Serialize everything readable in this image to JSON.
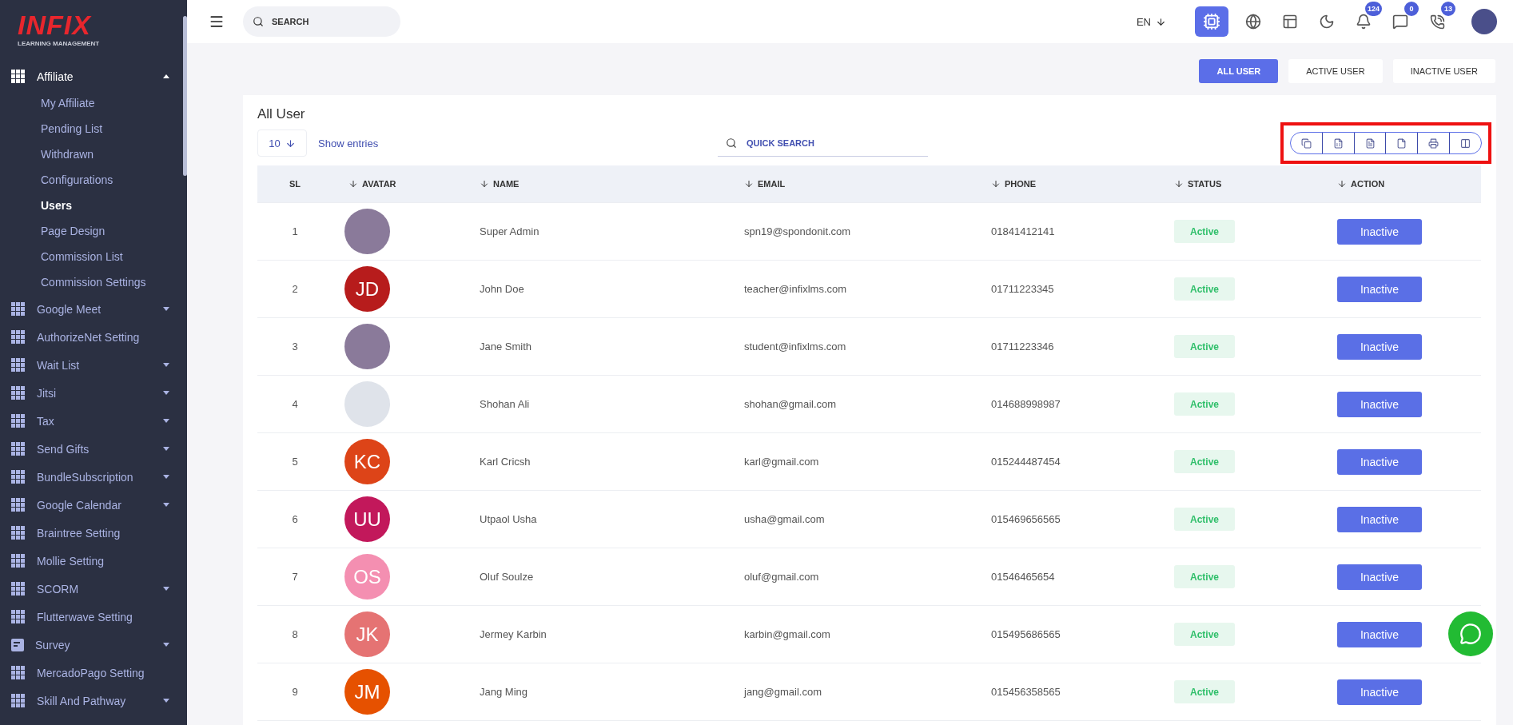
{
  "sidebar": {
    "logo": {
      "brand": "INFIX",
      "tagline": "LEARNING MANAGEMENT"
    },
    "items": [
      {
        "label": "Affiliate",
        "kind": "group",
        "expanded": true,
        "children": [
          {
            "label": "My Affiliate",
            "selected": false
          },
          {
            "label": "Pending List",
            "selected": false
          },
          {
            "label": "Withdrawn",
            "selected": false
          },
          {
            "label": "Configurations",
            "selected": false
          },
          {
            "label": "Users",
            "selected": true
          },
          {
            "label": "Page Design",
            "selected": false
          },
          {
            "label": "Commission List",
            "selected": false
          },
          {
            "label": "Commission Settings",
            "selected": false
          }
        ]
      },
      {
        "label": "Google Meet",
        "kind": "group",
        "expanded": false
      },
      {
        "label": "AuthorizeNet Setting",
        "kind": "link"
      },
      {
        "label": "Wait List",
        "kind": "group",
        "expanded": false
      },
      {
        "label": "Jitsi",
        "kind": "group",
        "expanded": false
      },
      {
        "label": "Tax",
        "kind": "group",
        "expanded": false
      },
      {
        "label": "Send Gifts",
        "kind": "group",
        "expanded": false
      },
      {
        "label": "BundleSubscription",
        "kind": "group",
        "expanded": false
      },
      {
        "label": "Google Calendar",
        "kind": "group",
        "expanded": false
      },
      {
        "label": "Braintree Setting",
        "kind": "link"
      },
      {
        "label": "Mollie Setting",
        "kind": "link"
      },
      {
        "label": "SCORM",
        "kind": "group",
        "expanded": false
      },
      {
        "label": "Flutterwave Setting",
        "kind": "link"
      },
      {
        "label": "Survey",
        "kind": "survey",
        "expanded": false
      },
      {
        "label": "MercadoPago Setting",
        "kind": "link"
      },
      {
        "label": "Skill And Pathway",
        "kind": "group",
        "expanded": false
      }
    ]
  },
  "topbar": {
    "search": {
      "placeholder": "SEARCH"
    },
    "language": "EN",
    "ai_active": true,
    "badges": {
      "notifications": "124",
      "messages": "0",
      "chats": "13"
    }
  },
  "tabs": [
    {
      "label": "ALL USER",
      "selected": true
    },
    {
      "label": "ACTIVE USER",
      "selected": false
    },
    {
      "label": "INACTIVE USER",
      "selected": false
    }
  ],
  "card": {
    "title": "All User",
    "page_size": "10",
    "show_entries": "Show entries",
    "quick_search": {
      "placeholder": "QUICK SEARCH"
    },
    "export_highlighted": true
  },
  "table": {
    "columns": [
      {
        "label": "SL",
        "sortable": false
      },
      {
        "label": "AVATAR",
        "sortable": true
      },
      {
        "label": "NAME",
        "sortable": true
      },
      {
        "label": "EMAIL",
        "sortable": true
      },
      {
        "label": "PHONE",
        "sortable": true
      },
      {
        "label": "STATUS",
        "sortable": true
      },
      {
        "label": "ACTION",
        "sortable": true
      }
    ],
    "rows": [
      {
        "sl": "1",
        "avatar": {
          "kind": "photo"
        },
        "name": "Super Admin",
        "email": "spn19@spondonit.com",
        "phone": "01841412141",
        "status": "Active",
        "action": "Inactive"
      },
      {
        "sl": "2",
        "avatar": {
          "kind": "initials",
          "initials": "JD",
          "color": "#b71c1c"
        },
        "name": "John Doe",
        "email": "teacher@infixlms.com",
        "phone": "01711223345",
        "status": "Active",
        "action": "Inactive"
      },
      {
        "sl": "3",
        "avatar": {
          "kind": "photo"
        },
        "name": "Jane Smith",
        "email": "student@infixlms.com",
        "phone": "01711223346",
        "status": "Active",
        "action": "Inactive"
      },
      {
        "sl": "4",
        "avatar": {
          "kind": "cartoon"
        },
        "name": "Shohan Ali",
        "email": "shohan@gmail.com",
        "phone": "014688998987",
        "status": "Active",
        "action": "Inactive"
      },
      {
        "sl": "5",
        "avatar": {
          "kind": "initials",
          "initials": "KC",
          "color": "#dd4418"
        },
        "name": "Karl Cricsh",
        "email": "karl@gmail.com",
        "phone": "015244487454",
        "status": "Active",
        "action": "Inactive"
      },
      {
        "sl": "6",
        "avatar": {
          "kind": "initials",
          "initials": "UU",
          "color": "#c2185b"
        },
        "name": "Utpaol Usha",
        "email": "usha@gmail.com",
        "phone": "015469656565",
        "status": "Active",
        "action": "Inactive"
      },
      {
        "sl": "7",
        "avatar": {
          "kind": "initials",
          "initials": "OS",
          "color": "#f48fb1"
        },
        "name": "Oluf Soulze",
        "email": "oluf@gmail.com",
        "phone": "01546465654",
        "status": "Active",
        "action": "Inactive"
      },
      {
        "sl": "8",
        "avatar": {
          "kind": "initials",
          "initials": "JK",
          "color": "#e57373"
        },
        "name": "Jermey Karbin",
        "email": "karbin@gmail.com",
        "phone": "015495686565",
        "status": "Active",
        "action": "Inactive"
      },
      {
        "sl": "9",
        "avatar": {
          "kind": "initials",
          "initials": "JM",
          "color": "#e65100"
        },
        "name": "Jang Ming",
        "email": "jang@gmail.com",
        "phone": "015456358565",
        "status": "Active",
        "action": "Inactive"
      }
    ]
  }
}
